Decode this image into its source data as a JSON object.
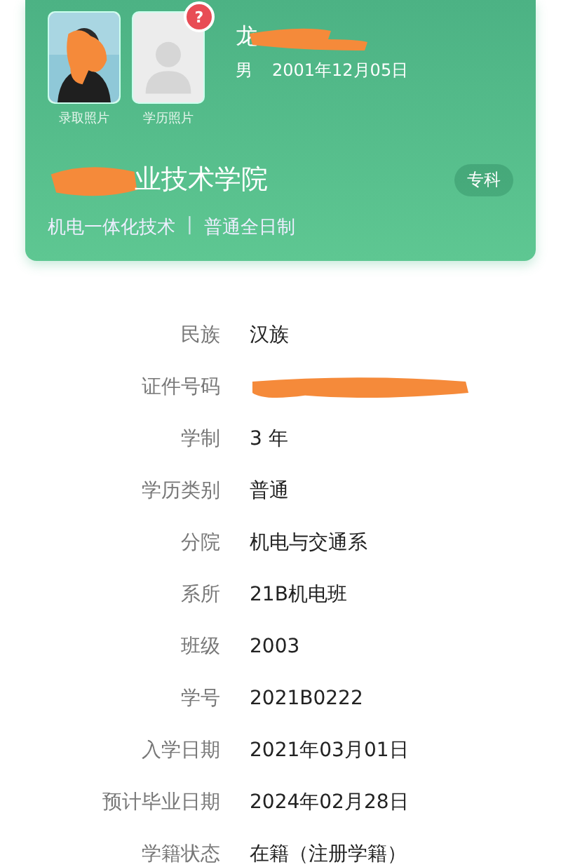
{
  "card": {
    "photos": [
      {
        "kind": "picture",
        "caption": "录取照片",
        "redacted": true
      },
      {
        "kind": "placeholder",
        "caption": "学历照片",
        "badge": "?"
      }
    ],
    "name": "龙",
    "name_redacted": true,
    "gender": "男",
    "birth_date": "2001年12月05日",
    "school": "业技术学院",
    "school_redacted": true,
    "level_tag": "专科",
    "major": "机电一体化技术",
    "separator": "|",
    "study_mode": "普通全日制"
  },
  "rows": [
    {
      "label": "民族",
      "kind": "text",
      "value": "汉族"
    },
    {
      "label": "证件号码",
      "kind": "redacted"
    },
    {
      "label": "学制",
      "kind": "text",
      "value": "3 年"
    },
    {
      "label": "学历类别",
      "kind": "text",
      "value": "普通"
    },
    {
      "label": "分院",
      "kind": "text",
      "value": "机电与交通系"
    },
    {
      "label": "系所",
      "kind": "text",
      "value": "21B机电班"
    },
    {
      "label": "班级",
      "kind": "text",
      "value": "2003"
    },
    {
      "label": "学号",
      "kind": "text",
      "value": "2021B0222"
    },
    {
      "label": "入学日期",
      "kind": "text",
      "value": "2021年03月01日"
    },
    {
      "label": "预计毕业日期",
      "kind": "text",
      "value": "2024年02月28日"
    },
    {
      "label": "学籍状态",
      "kind": "text",
      "value": "在籍（注册学籍）"
    }
  ]
}
